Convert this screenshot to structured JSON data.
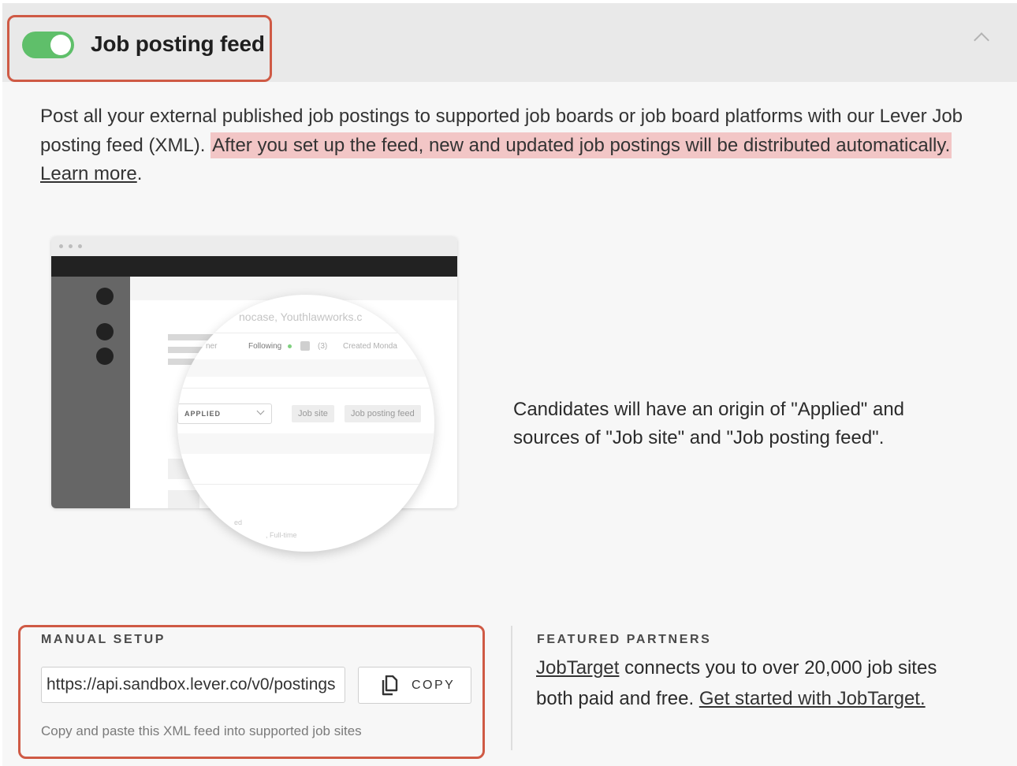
{
  "header": {
    "toggle_on": true,
    "title": "Job posting feed",
    "collapse_icon": "chevron-up-icon"
  },
  "description": {
    "text_before": "Post all your external published job postings to supported job boards or job board platforms with our Lever Job posting feed (XML). ",
    "highlighted": "After you set up the feed, new and updated job postings will be distributed automatically.",
    "link": "Learn more",
    "text_after": "."
  },
  "illustration": {
    "snippet_companies": "nocase, Youthlawworks.c",
    "snippet_owner": "ner",
    "snippet_following": "Following",
    "snippet_count": "(3)",
    "snippet_created": "Created Monda",
    "origin_select": "APPLIED",
    "source_tag_1": "Job site",
    "source_tag_2": "Job posting feed",
    "snippet_bottom_1": "ed",
    "snippet_bottom_2": ", Full-time"
  },
  "origin_note": "Candidates will have an origin of \"Applied\" and sources of \"Job site\" and \"Job posting feed\".",
  "manual_setup": {
    "label": "MANUAL SETUP",
    "url_value": "https://api.sandbox.lever.co/v0/postings",
    "copy_label": "COPY",
    "copy_icon": "copy-icon",
    "hint": "Copy and paste this XML feed into supported job sites"
  },
  "featured_partners": {
    "label": "FEATURED PARTNERS",
    "partner_link": "JobTarget",
    "text": " connects you to over 20,000 job sites both paid and free. ",
    "cta_link": "Get started with JobTarget."
  },
  "colors": {
    "toggle": "#5fbf6a",
    "highlight": "#f2c6c6",
    "annotation_box": "#cf5a45",
    "header_bg": "#e9e9e9"
  }
}
